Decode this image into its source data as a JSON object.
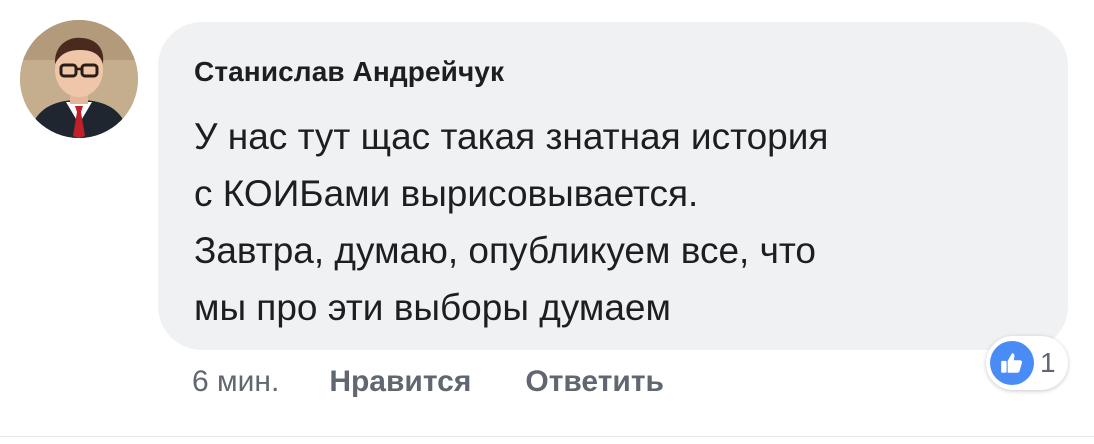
{
  "comment": {
    "author": "Станислав Андрейчук",
    "text_lines": [
      "У нас тут щас такая знатная история",
      "с КОИБами вырисовывается.",
      "Завтра, думаю, опубликуем все, что",
      "мы про эти выборы думаем"
    ],
    "timestamp": "6 мин.",
    "like_label": "Нравится",
    "reply_label": "Ответить",
    "reactions": {
      "icon": "thumbs-up-icon",
      "count": "1",
      "color": "#4a8cf5"
    }
  },
  "colors": {
    "bubble": "#f0f1f3",
    "text": "#1c1e21",
    "meta": "#606770"
  }
}
